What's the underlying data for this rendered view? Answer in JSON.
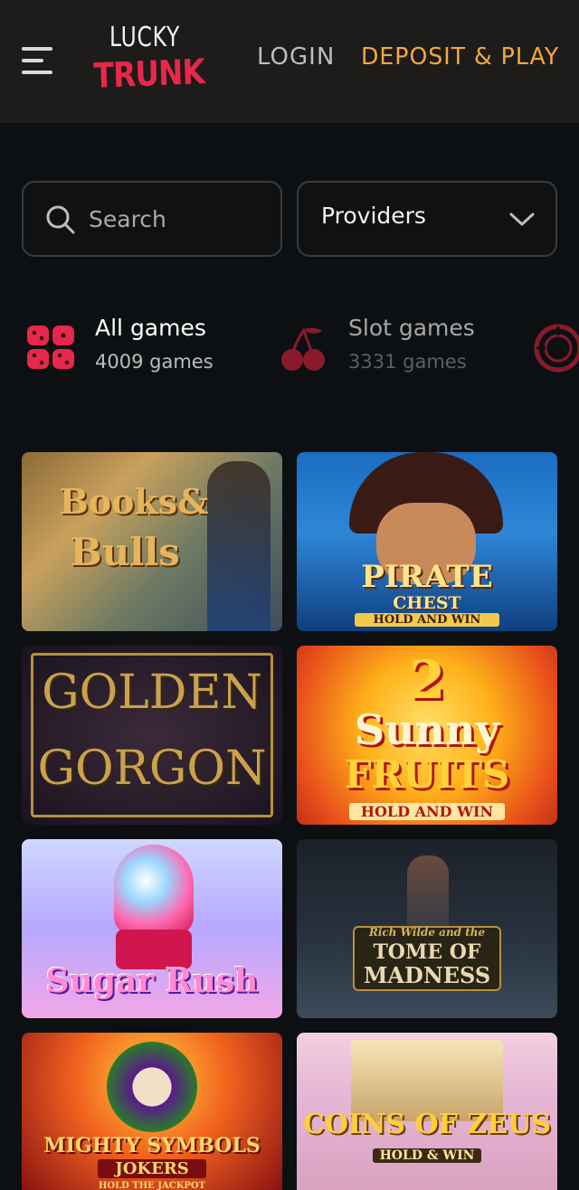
{
  "header": {
    "menu_icon": "hamburger-menu-icon",
    "logo": {
      "line1": "LUCKY",
      "line2": "TRUNK"
    },
    "login_label": "LOGIN",
    "deposit_label": "DEPOSIT & PLAY"
  },
  "colors": {
    "header_bg": "#1d1c1b",
    "page_bg": "#0d1012",
    "accent_orange": "#f5a83b",
    "brand_red": "#e8274b"
  },
  "search": {
    "placeholder": "Search",
    "value": "",
    "icon": "search-icon"
  },
  "providers": {
    "label": "Providers",
    "icon": "chevron-down-icon"
  },
  "categories": [
    {
      "name": "All games",
      "count": "4009 games",
      "icon": "grid-icon",
      "active": true
    },
    {
      "name": "Slot games",
      "count": "3331 games",
      "icon": "cherry-icon",
      "active": false
    }
  ],
  "games": [
    {
      "line1": "Books&",
      "line2": "Bulls"
    },
    {
      "line1": "PIRATE",
      "line2": "CHEST",
      "line3": "HOLD AND WIN"
    },
    {
      "line1": "GOLDEN",
      "line2": "GORGON"
    },
    {
      "line1": "2",
      "line2": "Sunny",
      "line3": "FRUITS",
      "line4": "HOLD AND WIN"
    },
    {
      "line1": "Sugar Rush"
    },
    {
      "line1": "Rich Wilde and the",
      "line2": "TOME OF",
      "line3": "MADNESS"
    },
    {
      "line1": "MIGHTY SYMBOLS",
      "line2": "JOKERS",
      "line3": "HOLD THE JACKPOT"
    },
    {
      "line1": "COINS OF ZEUS",
      "line2": "HOLD & WIN"
    }
  ]
}
